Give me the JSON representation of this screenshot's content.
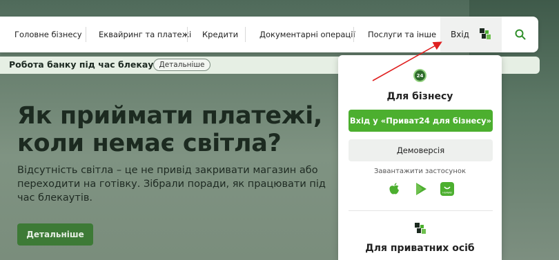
{
  "nav": {
    "items": [
      {
        "label": "Головне бізнесу"
      },
      {
        "label": "Еквайринг та платежі"
      },
      {
        "label": "Кредити"
      },
      {
        "label": "Документарні операції"
      },
      {
        "label": "Послуги та інше"
      }
    ],
    "login_label": "Вхід",
    "login_icon": "privat-logo-icon",
    "search_icon": "search-icon"
  },
  "notice": {
    "text": "Робота банку під час блекауту",
    "button_label": "Детальніше"
  },
  "hero": {
    "title_line1": "Як приймати платежі,",
    "title_line2": "коли немає світла?",
    "text": "Відсутність світла – це не привід закривати магазин або переходити на готівку. Зібрали поради, як працювати під час блекаутів.",
    "button_label": "Детальніше"
  },
  "panel": {
    "badge": "24",
    "business_heading": "Для бізнесу",
    "business_login_label": "Вхід у «Приват24 для бізнесу»",
    "demo_label": "Демоверсія",
    "app_label": "Завантажити застосунок",
    "stores": [
      "apple-icon",
      "google-play-icon",
      "huawei-appgallery-icon"
    ],
    "private_heading": "Для приватних осіб"
  },
  "colors": {
    "accent": "#4caf2f",
    "hero_button": "#3d7a36",
    "notice_bg": "#e6efe4",
    "arrow": "#e02020"
  }
}
